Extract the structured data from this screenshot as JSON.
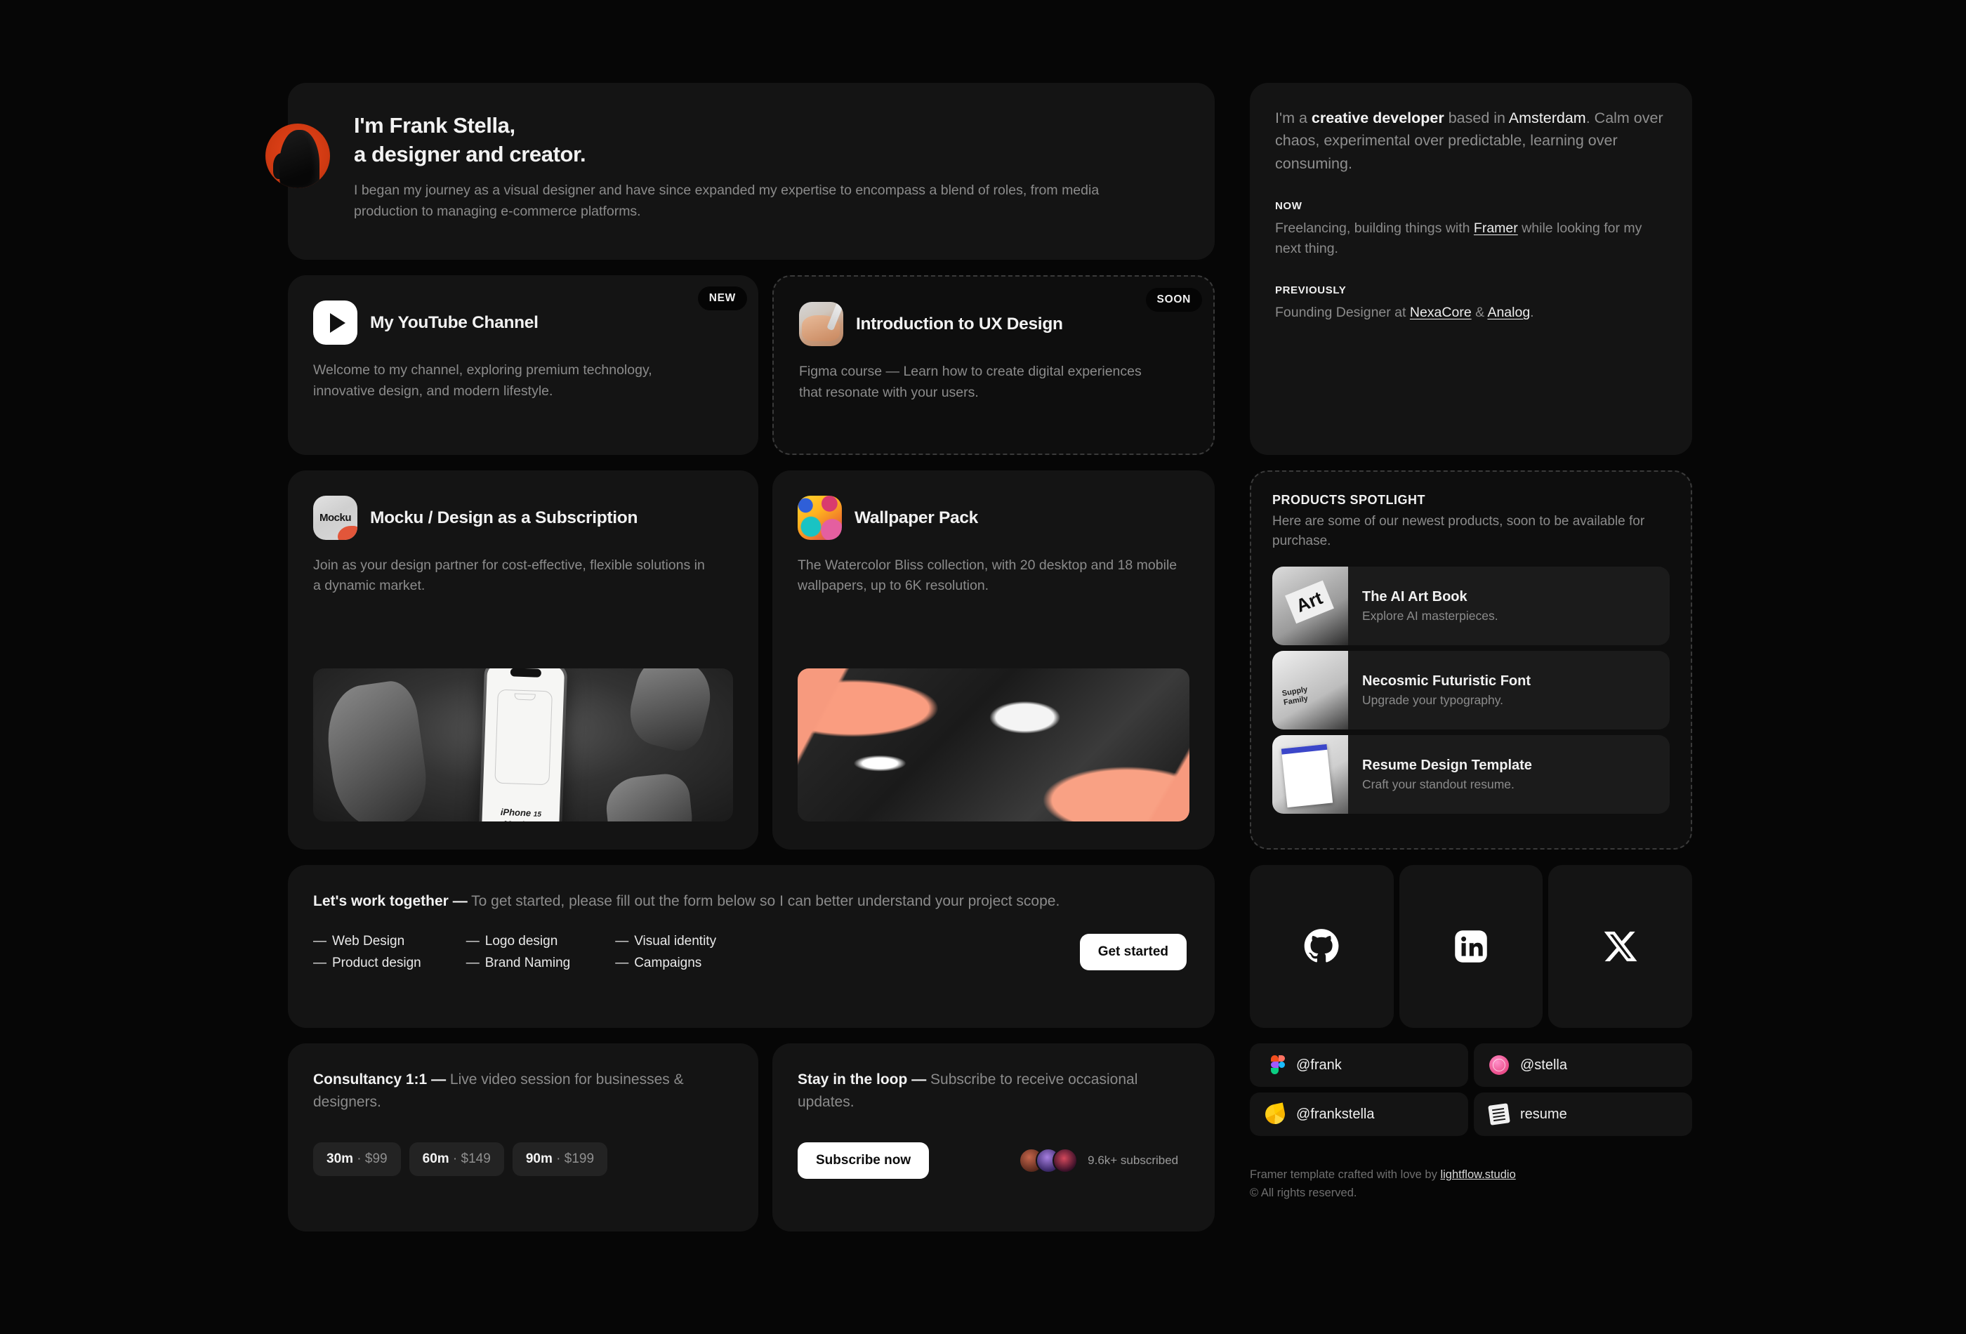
{
  "hero": {
    "title_line1": "I'm Frank Stella,",
    "title_line2": "a designer and creator.",
    "description": "I began my journey as a visual designer and have since expanded my expertise to encompass a blend of roles, from media production to managing e-commerce platforms."
  },
  "about": {
    "lead_pre": "I'm a ",
    "lead_bold": "creative developer",
    "lead_mid": " based in ",
    "lead_loc": "Amsterdam",
    "lead_post": ". Calm over chaos, experimental over predictable, learning over consuming.",
    "now_label": "NOW",
    "now_pre": "Freelancing, building things with ",
    "now_link": "Framer",
    "now_post": " while looking for my next thing.",
    "prev_label": "PREVIOUSLY",
    "prev_pre": "Founding Designer at ",
    "prev_link1": "NexaCore",
    "prev_amp": " & ",
    "prev_link2": "Analog",
    "prev_post": "."
  },
  "links": [
    {
      "badge": "NEW",
      "title": "My YouTube Channel",
      "description": "Welcome to my channel, exploring premium technology, innovative design, and modern lifestyle."
    },
    {
      "badge": "SOON",
      "title": "Introduction to UX Design",
      "description": "Figma course — Learn how to create digital experiences that resonate with your users."
    }
  ],
  "products": [
    {
      "icon_text": "Mocku",
      "title": "Mocku / Design as a Subscription",
      "description": "Join as your design partner for cost-effective, flexible solutions in a dynamic market.",
      "shot_label_line1": "iPhone",
      "shot_label_num": "15",
      "shot_label_line2": "Mockup"
    },
    {
      "title": "Wallpaper Pack",
      "description": "The Watercolor Bliss collection, with 20 desktop and 18 mobile wallpapers, up to 6K resolution."
    }
  ],
  "spotlight": {
    "title": "PRODUCTS SPOTLIGHT",
    "subtitle": "Here are some of our newest products, soon to be available for purchase.",
    "items": [
      {
        "name": "The AI Art Book",
        "description": "Explore AI masterpieces."
      },
      {
        "name": "Necosmic Futuristic Font",
        "description": "Upgrade your typography."
      },
      {
        "name": "Resume Design Template",
        "description": "Craft your standout resume."
      }
    ]
  },
  "work": {
    "title": "Let's work together",
    "dash": "—",
    "description": "To get started, please fill out the form below so I can better understand your project scope.",
    "services_col1": [
      "Web Design",
      "Product design"
    ],
    "services_col2": [
      "Logo design",
      "Brand Naming"
    ],
    "services_col3": [
      "Visual identity",
      "Campaigns"
    ],
    "bullet": "—",
    "cta": "Get started"
  },
  "socials": [
    {
      "name": "github"
    },
    {
      "name": "linkedin"
    },
    {
      "name": "x-twitter"
    }
  ],
  "consultancy": {
    "title": "Consultancy 1:1",
    "dash": "—",
    "description": "Live video session for businesses & designers.",
    "pills": [
      {
        "duration": "30m",
        "sep": " · ",
        "price": "$99"
      },
      {
        "duration": "60m",
        "sep": " · ",
        "price": "$149"
      },
      {
        "duration": "90m",
        "sep": " · ",
        "price": "$199"
      }
    ]
  },
  "loop": {
    "title": "Stay in the loop",
    "dash": "—",
    "description": "Subscribe to receive occasional updates.",
    "cta": "Subscribe now",
    "subscribers": "9.6k+ subscribed"
  },
  "handles": [
    {
      "icon": "figma-icon",
      "label": "@frank"
    },
    {
      "icon": "dribbble-icon",
      "label": "@stella"
    },
    {
      "icon": "gumroad-icon",
      "label": "@frankstella"
    },
    {
      "icon": "document-icon",
      "label": "resume"
    }
  ],
  "footer": {
    "credit_pre": "Framer template crafted with love by ",
    "credit_link": "lightflow.studio",
    "rights": "© All rights reserved."
  },
  "colors": {
    "background": "#060606",
    "card": "#141414",
    "accent_orange": "#e8441a",
    "text_primary": "#f2f2f2",
    "text_muted": "#8b8b8b"
  }
}
